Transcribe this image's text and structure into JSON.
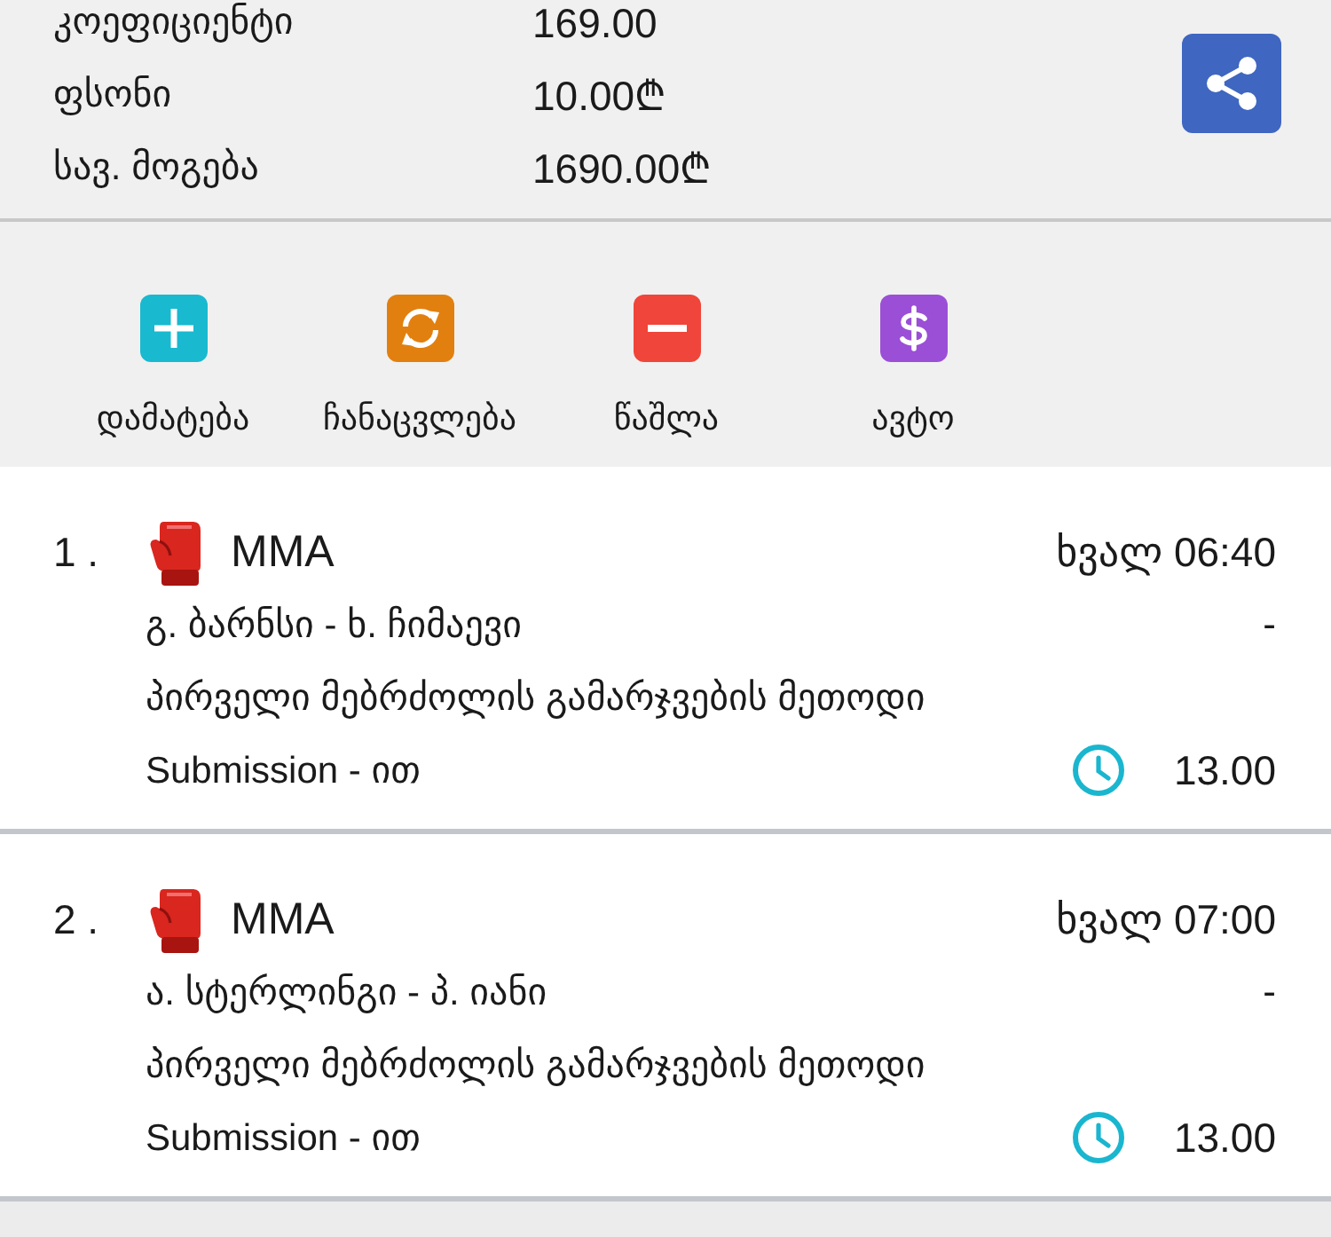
{
  "summary": {
    "rows": [
      {
        "label": "კოეფიციენტი",
        "value": "169.00"
      },
      {
        "label": "ფსონი",
        "value": "10.00₾"
      },
      {
        "label": "სავ. მოგება",
        "value": "1690.00₾"
      }
    ]
  },
  "actions": [
    {
      "kind": "add",
      "label": "დამატება",
      "color": "#19b9d0"
    },
    {
      "kind": "replace",
      "label": "ჩანაცვლება",
      "color": "#e2800f"
    },
    {
      "kind": "remove",
      "label": "წაშლა",
      "color": "#f0453a"
    },
    {
      "kind": "auto",
      "label": "ავტო",
      "color": "#9b4fd6"
    }
  ],
  "bets": [
    {
      "number": "1 .",
      "sport": "MMA",
      "time": "ხვალ 06:40",
      "match": "გ. ბარნსი - ხ. ჩიმაევი",
      "score": "-",
      "market": "პირველი მებრძოლის გამარჯვების მეთოდი",
      "selection": "Submission - ით",
      "odds": "13.00"
    },
    {
      "number": "2 .",
      "sport": "MMA",
      "time": "ხვალ 07:00",
      "match": "ა. სტერლინგი - პ. იანი",
      "score": "-",
      "market": "პირველი მებრძოლის გამარჯვების მეთოდი",
      "selection": "Submission - ით",
      "odds": "13.00"
    }
  ]
}
